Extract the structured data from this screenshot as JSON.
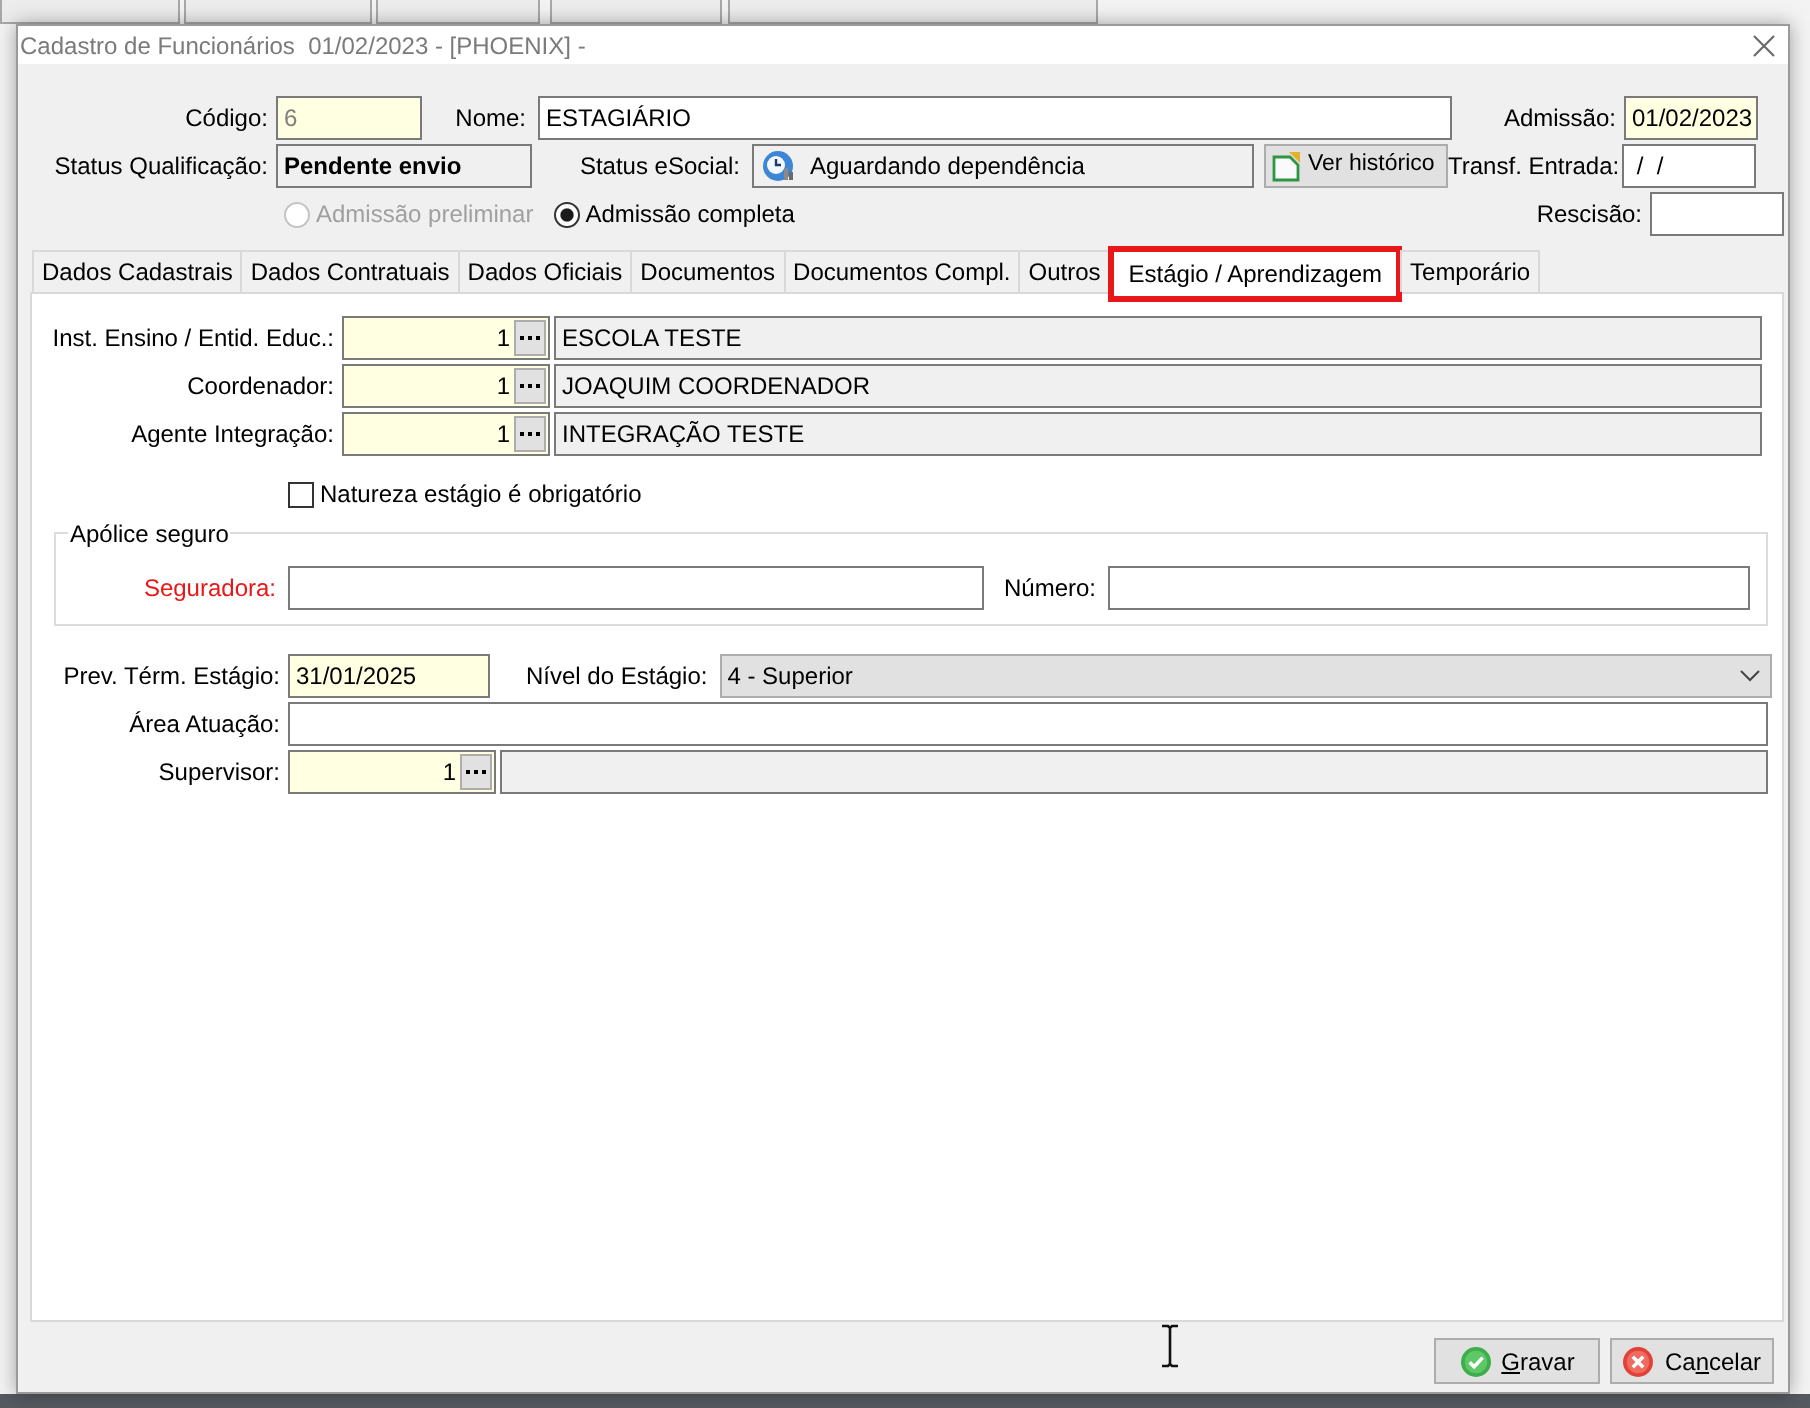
{
  "window": {
    "title": "Cadastro de Funcionários  01/02/2023 - [PHOENIX] -"
  },
  "header": {
    "codigo": {
      "label": "Código:",
      "value": "6",
      "highlighted": true,
      "disabled": true
    },
    "nome": {
      "label": "Nome:",
      "value": "ESTAGIÁRIO",
      "highlighted": false
    },
    "admissao": {
      "label": "Admissão:",
      "value": "01/02/2023",
      "highlighted": true
    },
    "status_qualificacao": {
      "label": "Status Qualificação:",
      "value": "Pendente envio"
    },
    "status_esocial": {
      "label": "Status eSocial:",
      "value": "Aguardando dependência"
    },
    "history_button": {
      "label": "Ver histórico"
    },
    "transf_entrada": {
      "label": "Transf. Entrada:",
      "value": " /  /",
      "highlighted": false
    },
    "rescisao": {
      "label": "Rescisão:",
      "highlighted": false
    },
    "admission_types": [
      {
        "label": "Admissão preliminar",
        "selected": false,
        "disabled": true
      },
      {
        "label": "Admissão completa",
        "selected": true,
        "disabled": false
      }
    ]
  },
  "tabs": [
    {
      "label": "Dados Cadastrais",
      "selected": false,
      "highlighted": false
    },
    {
      "label": "Dados Contratuais",
      "selected": false,
      "highlighted": false
    },
    {
      "label": "Dados Oficiais",
      "selected": false,
      "highlighted": false
    },
    {
      "label": "Documentos",
      "selected": false,
      "highlighted": false
    },
    {
      "label": "Documentos Compl.",
      "selected": false,
      "highlighted": false
    },
    {
      "label": "Outros",
      "selected": false,
      "highlighted": false
    },
    {
      "label": "Estágio / Aprendizagem",
      "selected": true,
      "highlighted": true
    },
    {
      "label": "Temporário",
      "selected": false,
      "highlighted": false
    }
  ],
  "lookups": [
    {
      "label": "Inst. Ensino / Entid. Educ.:",
      "code": "1",
      "name": "ESCOLA TESTE"
    },
    {
      "label": "Coordenador:",
      "code": "1",
      "name": "JOAQUIM COORDENADOR"
    },
    {
      "label": "Agente Integração:",
      "code": "1",
      "name": "INTEGRAÇÃO TESTE"
    }
  ],
  "mandatory_checkbox": {
    "label": "Natureza estágio é obrigatório",
    "checked": false
  },
  "insurance": {
    "title": "Apólice seguro",
    "fields": [
      {
        "label": "Seguradora:",
        "required": true
      },
      {
        "label": "Número:",
        "required": false
      }
    ]
  },
  "end_date": {
    "label": "Prev. Térm. Estágio:",
    "value": "31/01/2025",
    "highlighted": true
  },
  "level": {
    "label": "Nível do Estágio:",
    "value": "4 - Superior"
  },
  "area": {
    "label": "Área Atuação:",
    "highlighted": false
  },
  "supervisor": {
    "label": "Supervisor:",
    "code": "1"
  },
  "buttons": [
    {
      "kind": "save",
      "parts": [
        {
          "text": "G",
          "underlined": true
        },
        {
          "text": "ravar",
          "underlined": false
        }
      ]
    },
    {
      "kind": "cancel",
      "parts": [
        {
          "text": "Ca",
          "underlined": false
        },
        {
          "text": "n",
          "underlined": true
        },
        {
          "text": "celar",
          "underlined": false
        }
      ]
    }
  ]
}
